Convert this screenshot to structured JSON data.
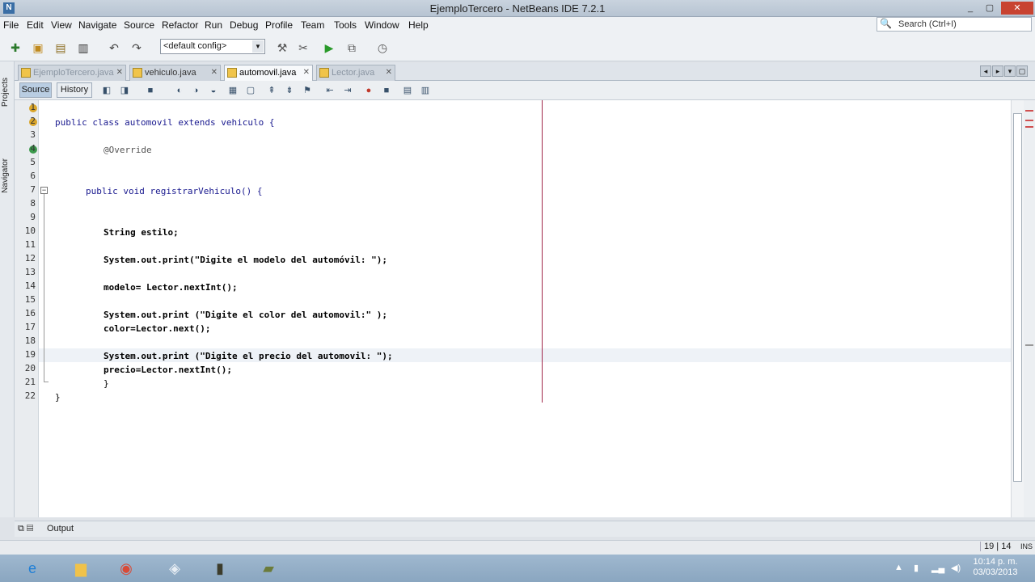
{
  "window": {
    "title": "EjemploTercero - NetBeans IDE 7.2.1",
    "minimize": "_",
    "maximize": "▢",
    "close": "✕"
  },
  "menu": [
    "File",
    "Edit",
    "View",
    "Navigate",
    "Source",
    "Refactor",
    "Run",
    "Debug",
    "Profile",
    "Team",
    "Tools",
    "Window",
    "Help"
  ],
  "search": {
    "placeholder": "Search (Ctrl+I)"
  },
  "toolbar": {
    "config_value": "<default config>"
  },
  "side_panels": [
    "Projects",
    "Navigator"
  ],
  "tabs": [
    {
      "label": "EjemploTercero.java",
      "active": false
    },
    {
      "label": "vehiculo.java",
      "active": false
    },
    {
      "label": "automovil.java",
      "active": true
    },
    {
      "label": "Lector.java",
      "active": false
    }
  ],
  "editor_tabs": {
    "source": "Source",
    "history": "History"
  },
  "code_lines": [
    {
      "n": "1",
      "text": ""
    },
    {
      "n": "2",
      "text": "public class automovil extends vehiculo {"
    },
    {
      "n": "3",
      "text": ""
    },
    {
      "n": "4",
      "text": "@Override"
    },
    {
      "n": "5",
      "text": ""
    },
    {
      "n": "6",
      "text": ""
    },
    {
      "n": "7",
      "text": "public void registrarVehiculo() {"
    },
    {
      "n": "8",
      "text": ""
    },
    {
      "n": "9",
      "text": ""
    },
    {
      "n": "10",
      "text": "String estilo;"
    },
    {
      "n": "11",
      "text": ""
    },
    {
      "n": "12",
      "text": "System.out.print(\"Digite el modelo del automóvil: \");"
    },
    {
      "n": "13",
      "text": ""
    },
    {
      "n": "14",
      "text": "modelo= Lector.nextInt();"
    },
    {
      "n": "15",
      "text": ""
    },
    {
      "n": "16",
      "text": "System.out.print (\"Digite el color del automovil:\" );"
    },
    {
      "n": "17",
      "text": "color=Lector.next();"
    },
    {
      "n": "18",
      "text": ""
    },
    {
      "n": "19",
      "text": "System.out.print (\"Digite el precio del automovil: \");"
    },
    {
      "n": "20",
      "text": "precio=Lector.nextInt();"
    },
    {
      "n": "21",
      "text": "}"
    },
    {
      "n": "22",
      "text": "}"
    }
  ],
  "output": {
    "label": "Output"
  },
  "status": {
    "position": "19 | 14",
    "mode": "INS"
  },
  "taskbar": {
    "apps": [
      "internet-explorer",
      "file-explorer",
      "chrome",
      "box-app",
      "jar-app",
      "netbeans"
    ],
    "time": "10:14 p. m.",
    "date": "03/03/2013"
  },
  "colors": {
    "keyword": "#1a1a8f",
    "margin": "#a0284b",
    "title_bar": "#c9d3de",
    "taskbar": "#8aa6c0"
  }
}
